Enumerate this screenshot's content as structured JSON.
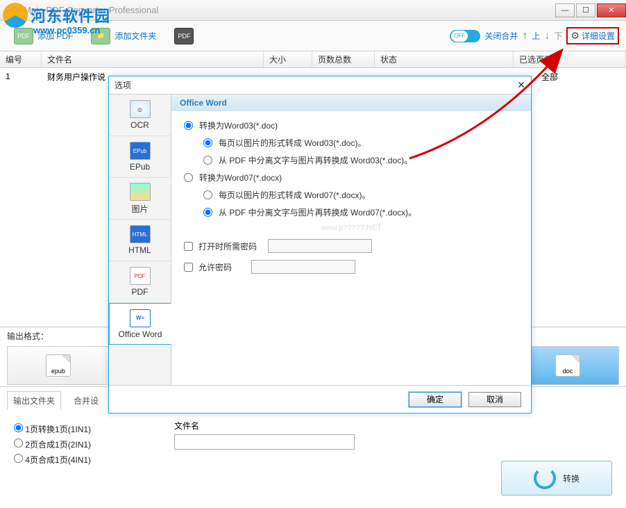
{
  "window": {
    "title": "PDFMate PDF Converter Professional"
  },
  "watermark": {
    "text": "河东软件园",
    "sub": "www.pc0359.cn"
  },
  "toolbar": {
    "add_pdf": "添加 PDF",
    "add_folder": "添加文件夹",
    "close_merge": "关闭合并",
    "up": "上",
    "down": "下",
    "detail_settings": "详细设置"
  },
  "columns": {
    "c1": "编号",
    "c2": "文件名",
    "c3": "大小",
    "c4": "页数总数",
    "c5": "状态",
    "c6": "已选页面"
  },
  "rows": [
    {
      "no": "1",
      "name": "财务用户操作说",
      "selected": "全部"
    }
  ],
  "output": {
    "format_label": "输出格式：",
    "epub": "epub",
    "doc": "doc",
    "folder_tab": "输出文件夹",
    "merge_tab": "合并设",
    "r1": "1页转换1页(1IN1)",
    "r2": "2页合成1页(2IN1)",
    "r3": "4页合成1页(4IN1)",
    "filename_label": "文件名",
    "convert": "转换"
  },
  "dialog": {
    "title": "选项",
    "tabs": {
      "ocr": "OCR",
      "epub": "EPub",
      "image": "图片",
      "html": "HTML",
      "pdf": "PDF",
      "word": "Office Word"
    },
    "panel_title": "Office Word",
    "opt1": "转换为Word03(*.doc)",
    "opt1a": "每页以图片的形式转成 Word03(*.doc)。",
    "opt1b": "从 PDF 中分离文字与图片再转换成 Word03(*.doc)。",
    "opt2": "转换为Word07(*.docx)",
    "opt2a": "每页以图片的形式转成 Word07(*.docx)。",
    "opt2b": "从 PDF 中分离文字与图片再转换成 Word07(*.docx)。",
    "chk_open_pw": "打开时所需密码",
    "chk_allow_pw": "允许密码",
    "wm": "www.p?????.NET",
    "ok": "确定",
    "cancel": "取消"
  }
}
